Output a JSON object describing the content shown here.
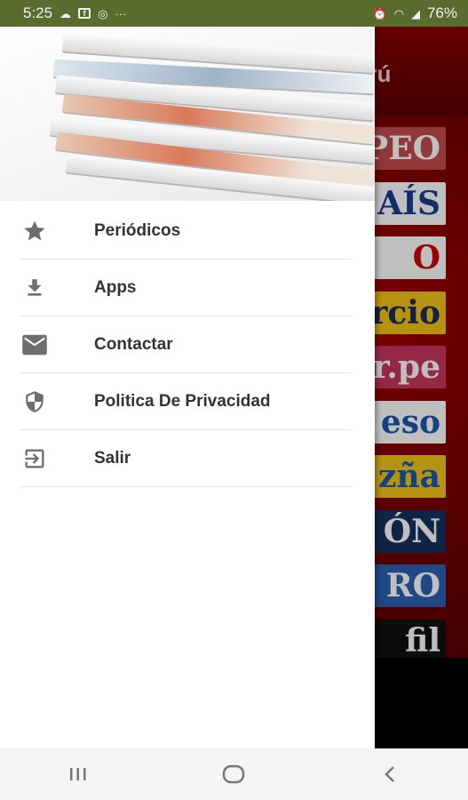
{
  "status_bar": {
    "time": "5:25",
    "battery": "76%",
    "dots": "···"
  },
  "app": {
    "title": "erú",
    "logos": [
      {
        "text": "PEO",
        "bg": "#c54b4b",
        "fg": "#ffffff"
      },
      {
        "text": "AÍS",
        "bg": "#ffffff",
        "fg": "#1a3d8f"
      },
      {
        "text": "O",
        "bg": "#ffffff",
        "fg": "#cc0000"
      },
      {
        "text": "ercio",
        "bg": "#f2c318",
        "fg": "#1a2a5a"
      },
      {
        "text": "ar.pe",
        "bg": "#c7355f",
        "fg": "#ffffff"
      },
      {
        "text": "eso",
        "bg": "#ffffff",
        "fg": "#1a58b0"
      },
      {
        "text": "zña",
        "bg": "#f2c318",
        "fg": "#1a58b0"
      },
      {
        "text": "ÓN",
        "bg": "#14325e",
        "fg": "#ffffff"
      },
      {
        "text": "RO",
        "bg": "#2b5fb3",
        "fg": "#ffffff"
      },
      {
        "text": "fil",
        "bg": "#111111",
        "fg": "#ffffff"
      }
    ]
  },
  "menu": {
    "items": [
      {
        "label": "Periódicos",
        "icon": "star-icon"
      },
      {
        "label": "Apps",
        "icon": "download-icon"
      },
      {
        "label": "Contactar",
        "icon": "envelope-icon"
      },
      {
        "label": "Politica De Privacidad",
        "icon": "shield-icon"
      },
      {
        "label": "Salir",
        "icon": "exit-icon"
      }
    ]
  },
  "colors": {
    "status_bar": "#5a6b2e",
    "icon_gray": "#6e6e6e",
    "text": "#333333"
  }
}
